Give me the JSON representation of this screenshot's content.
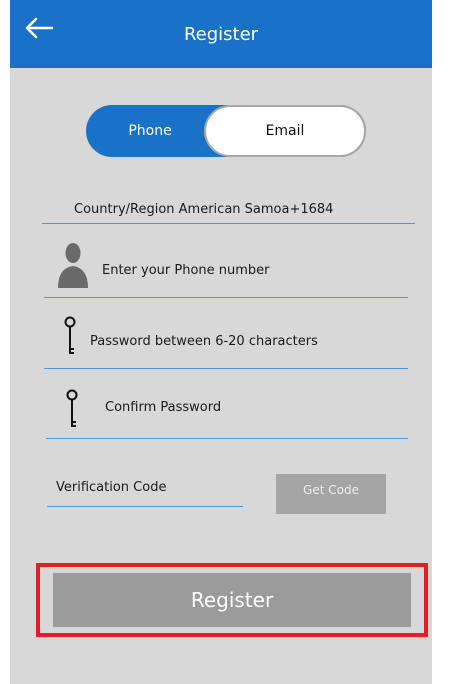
{
  "header": {
    "title": "Register",
    "back_icon": "arrow-left-icon"
  },
  "toggle": {
    "phone_label": "Phone",
    "email_label": "Email",
    "selected": "Phone"
  },
  "fields": {
    "country": "Country/Region American Samoa+1684",
    "phone_placeholder": "Enter your Phone number",
    "password_placeholder": "Password between 6-20 characters",
    "confirm_placeholder": "Confirm Password",
    "code_placeholder": "Verification Code"
  },
  "buttons": {
    "get_code": "Get Code",
    "register": "Register"
  },
  "colors": {
    "brand": "#1a72c7",
    "underline": "#4a98df",
    "highlight": "#e41e25",
    "disabled": "#9b9b9b"
  }
}
